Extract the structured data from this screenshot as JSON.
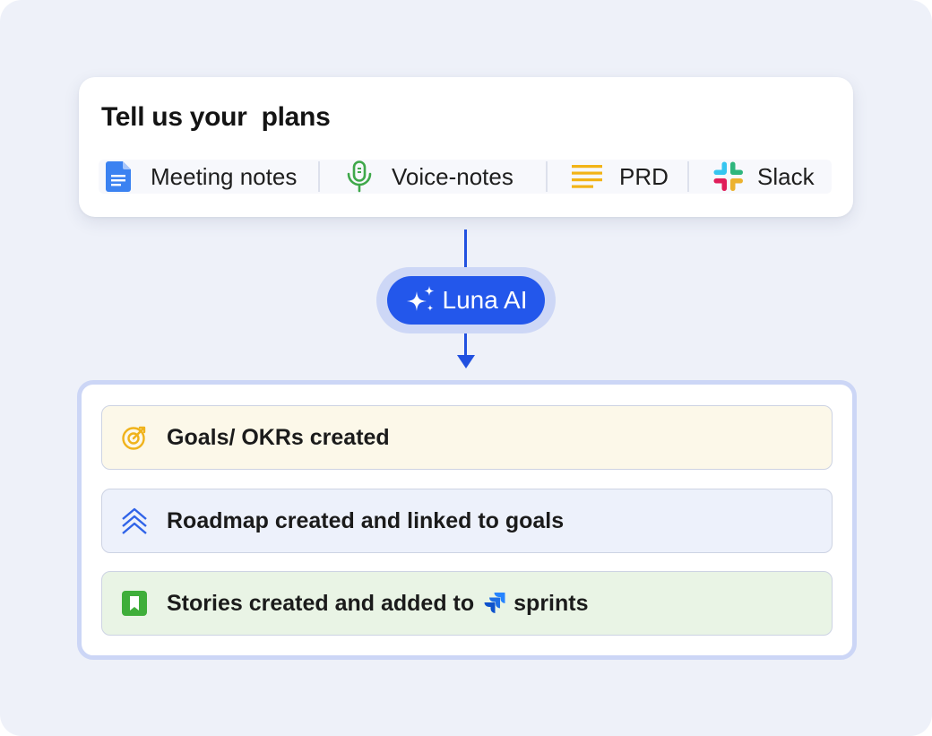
{
  "plans_card": {
    "title": "Tell us your  plans",
    "sources": [
      {
        "label": "Meeting notes",
        "icon": "google-docs-icon"
      },
      {
        "label": "Voice-notes",
        "icon": "microphone-icon"
      },
      {
        "label": "PRD",
        "icon": "document-lines-icon"
      },
      {
        "label": "Slack",
        "icon": "slack-icon"
      }
    ]
  },
  "luna": {
    "label": "Luna AI",
    "icon": "sparkles-icon"
  },
  "results": {
    "goals": {
      "text": "Goals/ OKRs created",
      "icon": "target-icon"
    },
    "roadmap": {
      "text": "Roadmap created and linked to goals",
      "icon": "chevrons-up-icon"
    },
    "stories": {
      "text_before": "Stories created and added to",
      "text_after": "sprints",
      "icon": "bookmark-icon",
      "inline_icon": "jira-icon"
    }
  },
  "colors": {
    "background": "#eef1f9",
    "accent": "#2357eb",
    "goals_bg": "#fcf8e9",
    "roadmap_bg": "#edf1fb",
    "stories_bg": "#e9f4e5"
  }
}
